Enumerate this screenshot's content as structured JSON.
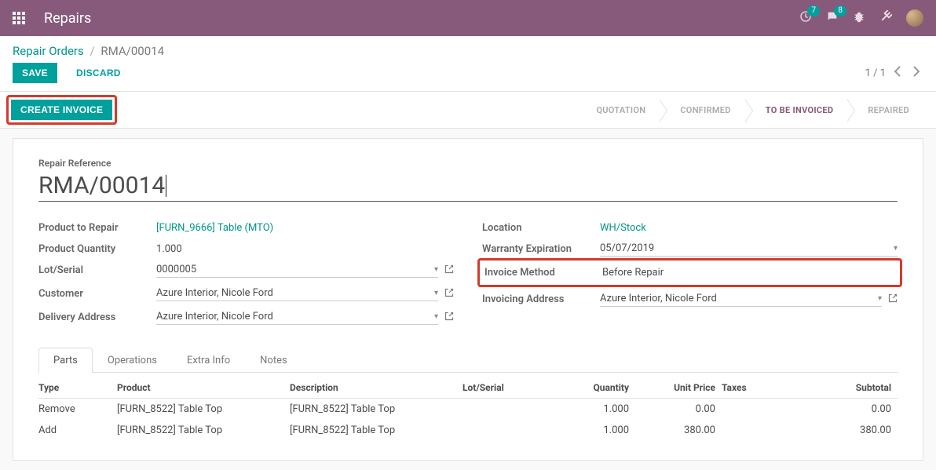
{
  "header": {
    "app_name": "Repairs",
    "activities_badge": "7",
    "messages_badge": "8"
  },
  "breadcrumb": {
    "root": "Repair Orders",
    "current": "RMA/00014"
  },
  "actions": {
    "save": "SAVE",
    "discard": "DISCARD",
    "create_invoice": "CREATE INVOICE"
  },
  "pager": {
    "text": "1 / 1"
  },
  "status": {
    "quotation": "QUOTATION",
    "confirmed": "CONFIRMED",
    "to_be_invoiced": "TO BE INVOICED",
    "repaired": "REPAIRED"
  },
  "form": {
    "ref_label": "Repair Reference",
    "ref_value": "RMA/00014",
    "left": {
      "product_label": "Product to Repair",
      "product_value": "[FURN_9666] Table (MTO)",
      "qty_label": "Product Quantity",
      "qty_value": "1.000",
      "lot_label": "Lot/Serial",
      "lot_value": "0000005",
      "customer_label": "Customer",
      "customer_value": "Azure Interior, Nicole Ford",
      "delivery_label": "Delivery Address",
      "delivery_value": "Azure Interior, Nicole Ford"
    },
    "right": {
      "location_label": "Location",
      "location_value": "WH/Stock",
      "warranty_label": "Warranty Expiration",
      "warranty_value": "05/07/2019",
      "invoice_method_label": "Invoice Method",
      "invoice_method_value": "Before Repair",
      "invoice_addr_label": "Invoicing Address",
      "invoice_addr_value": "Azure Interior, Nicole Ford"
    }
  },
  "tabs": {
    "parts": "Parts",
    "operations": "Operations",
    "extra": "Extra Info",
    "notes": "Notes"
  },
  "table": {
    "headers": {
      "type": "Type",
      "product": "Product",
      "description": "Description",
      "lot": "Lot/Serial",
      "quantity": "Quantity",
      "unit_price": "Unit Price",
      "taxes": "Taxes",
      "subtotal": "Subtotal"
    },
    "rows": [
      {
        "type": "Remove",
        "product": "[FURN_8522] Table Top",
        "description": "[FURN_8522] Table Top",
        "lot": "",
        "quantity": "1.000",
        "unit_price": "0.00",
        "taxes": "",
        "subtotal": "0.00"
      },
      {
        "type": "Add",
        "product": "[FURN_8522] Table Top",
        "description": "[FURN_8522] Table Top",
        "lot": "",
        "quantity": "1.000",
        "unit_price": "380.00",
        "taxes": "",
        "subtotal": "380.00"
      }
    ]
  }
}
